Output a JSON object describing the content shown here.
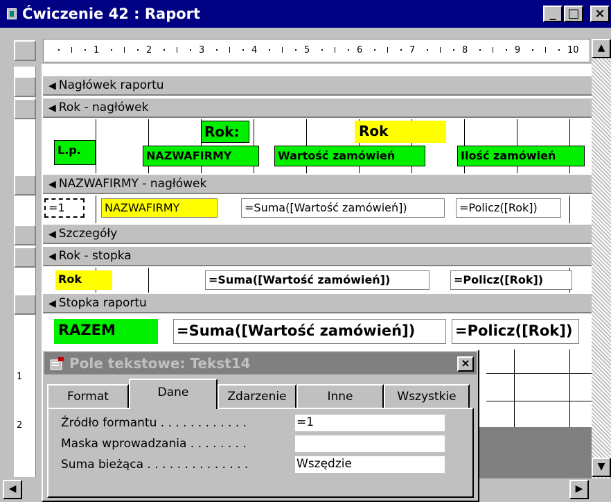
{
  "window": {
    "title": "Ćwiczenie 42 : Raport",
    "minimize_symbol": "_",
    "maximize_symbol": "□",
    "close_symbol": "×"
  },
  "ruler": {
    "labels": [
      "1",
      "2",
      "3",
      "4",
      "5",
      "6",
      "7",
      "8",
      "9",
      "10"
    ]
  },
  "sections": {
    "report_header": "Nagłówek raportu",
    "rok_header": "Rok - nagłówek",
    "firm_header": "NAZWAFIRMY - nagłówek",
    "details": "Szczegóły",
    "rok_footer": "Rok - stopka",
    "report_footer": "Stopka raportu"
  },
  "rok_header_controls": {
    "rok_label": "Rok:",
    "rok_field": "Rok",
    "lp_label": "L.p.",
    "nazwafirmy_label": "NAZWAFIRMY",
    "wartosc_label": "Wartość zamówień",
    "ilosc_label": "Ilość zamówień"
  },
  "firm_header_controls": {
    "counter": "=1",
    "nazwafirmy_field": "NAZWAFIRMY",
    "sum_field": "=Suma([Wartość zamówień])",
    "count_field": "=Policz([Rok])"
  },
  "rok_footer_controls": {
    "rok_field": "Rok",
    "sum_field": "=Suma([Wartość zamówień])",
    "count_field": "=Policz([Rok])"
  },
  "report_footer_controls": {
    "razem_label": "RAZEM",
    "sum_field": "=Suma([Wartość zamówień])",
    "count_field": "=Policz([Rok])"
  },
  "vertical_ruler": {
    "marks": [
      "1",
      "2"
    ]
  },
  "dialog": {
    "title": "Pole tekstowe: Tekst14",
    "close_symbol": "×",
    "tabs": [
      "Format",
      "Dane",
      "Zdarzenie",
      "Inne",
      "Wszystkie"
    ],
    "active_tab": "Dane",
    "properties": [
      {
        "label": "Źródło formantu . . . . . . . . . . . .",
        "value": "=1"
      },
      {
        "label": "Maska wprowadzania . . . . . . . .",
        "value": ""
      },
      {
        "label": "Suma bieżąca . . . . . . . . . . . . . .",
        "value": "Wszędzie"
      }
    ]
  },
  "colors": {
    "title_bar": "#000082",
    "label_green": "#00f000",
    "field_yellow": "#ffff00",
    "dialog_title_inactive": "#808080"
  },
  "scroll": {
    "up_arrow": "▲",
    "down_arrow": "▼",
    "left_arrow": "◀",
    "right_arrow": "▶"
  }
}
